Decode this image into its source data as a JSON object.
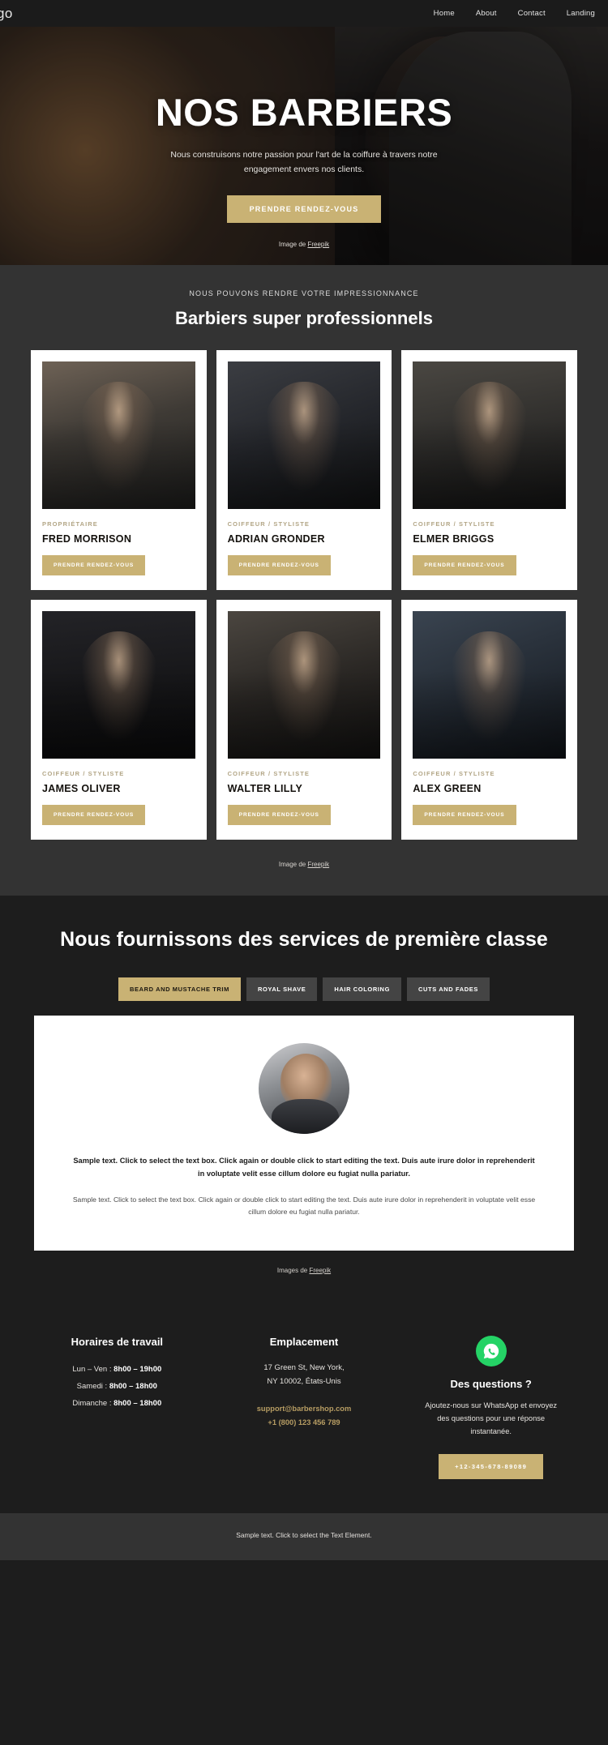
{
  "header": {
    "logo": "ogo",
    "nav": [
      {
        "label": "Home"
      },
      {
        "label": "About"
      },
      {
        "label": "Contact"
      },
      {
        "label": "Landing"
      }
    ]
  },
  "hero": {
    "title": "NOS BARBIERS",
    "subtitle": "Nous construisons notre passion pour l'art de la coiffure à travers notre engagement envers nos clients.",
    "cta_label": "PRENDRE RENDEZ-VOUS",
    "credit_prefix": "Image de ",
    "credit_link": "Freepik"
  },
  "team": {
    "eyebrow": "NOUS POUVONS RENDRE VOTRE IMPRESSIONNANCE",
    "title": "Barbiers super professionnels",
    "button_label": "PRENDRE RENDEZ-VOUS",
    "members": [
      {
        "role": "PROPRIÉTAIRE",
        "name": "FRED MORRISON"
      },
      {
        "role": "COIFFEUR / STYLISTE",
        "name": "ADRIAN GRONDER"
      },
      {
        "role": "COIFFEUR / STYLISTE",
        "name": "ELMER BRIGGS"
      },
      {
        "role": "COIFFEUR / STYLISTE",
        "name": "JAMES OLIVER"
      },
      {
        "role": "COIFFEUR / STYLISTE",
        "name": "WALTER LILLY"
      },
      {
        "role": "COIFFEUR / STYLISTE",
        "name": "ALEX GREEN"
      }
    ],
    "credit_prefix": "Image de ",
    "credit_link": "Freepik"
  },
  "services": {
    "title": "Nous fournissons des services de première classe",
    "tabs": [
      {
        "label": "BEARD AND MUSTACHE TRIM",
        "active": true
      },
      {
        "label": "ROYAL SHAVE",
        "active": false
      },
      {
        "label": "HAIR COLORING",
        "active": false
      },
      {
        "label": "CUTS AND FADES",
        "active": false
      }
    ],
    "lead": "Sample text. Click to select the text box. Click again or double click to start editing the text. Duis aute irure dolor in reprehenderit in voluptate velit esse cillum dolore eu fugiat nulla pariatur.",
    "body": "Sample text. Click to select the text box. Click again or double click to start editing the text. Duis aute irure dolor in reprehenderit in voluptate velit esse cillum dolore eu fugiat nulla pariatur.",
    "credit_prefix": "Images de ",
    "credit_link": "Freepik"
  },
  "footer": {
    "hours": {
      "title": "Horaires de travail",
      "rows": [
        {
          "day": "Lun – Ven : ",
          "time": "8h00 – 19h00"
        },
        {
          "day": "Samedi : ",
          "time": "8h00 – 18h00"
        },
        {
          "day": "Dimanche : ",
          "time": "8h00 – 18h00"
        }
      ]
    },
    "location": {
      "title": "Emplacement",
      "address_line1": "17 Green St, New York,",
      "address_line2": "NY 10002, États-Unis",
      "email": "support@barbershop.com",
      "phone": "+1 (800) 123 456 789"
    },
    "questions": {
      "title": "Des questions ?",
      "text": "Ajoutez-nous sur WhatsApp et envoyez des questions pour une réponse instantanée.",
      "button_label": "+12-345-678-89089"
    }
  },
  "bottom": {
    "text": "Sample text. Click to select the Text Element."
  },
  "colors": {
    "gold": "#c9b274",
    "gold_text": "#b79d63",
    "dark": "#1d1d1d",
    "mid_dark": "#333333",
    "whatsapp_green": "#25D366"
  }
}
